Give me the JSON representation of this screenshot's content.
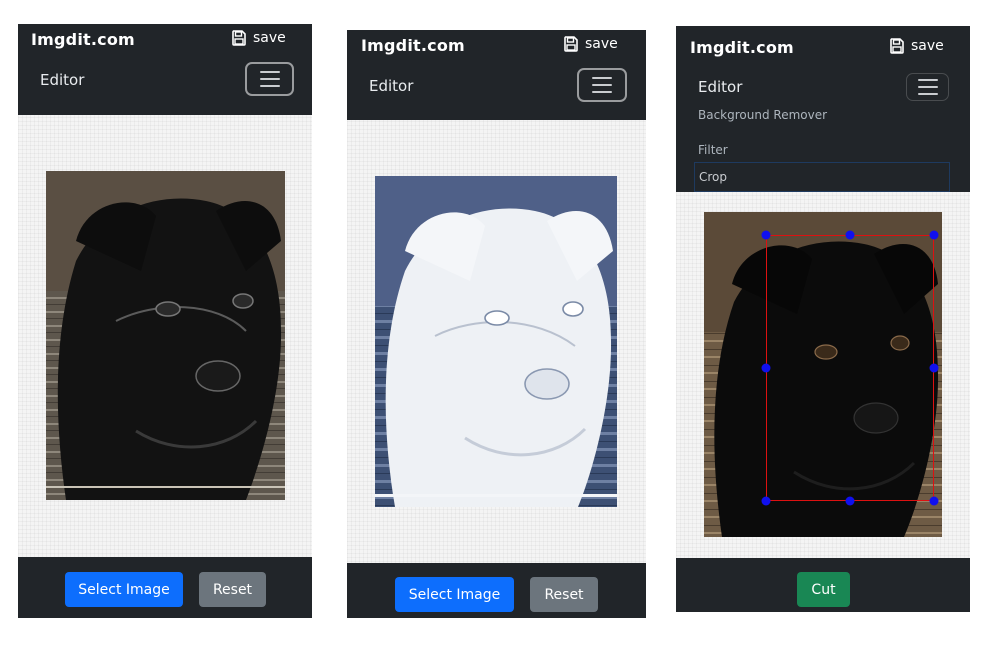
{
  "panels": [
    {
      "brand": "Imgdit.com",
      "save_label": "save",
      "editor_label": "Editor",
      "buttons": {
        "select": "Select Image",
        "reset": "Reset"
      },
      "image_filter": "emboss"
    },
    {
      "brand": "Imgdit.com",
      "save_label": "save",
      "editor_label": "Editor",
      "buttons": {
        "select": "Select Image",
        "reset": "Reset"
      },
      "image_filter": "sketch"
    },
    {
      "brand": "Imgdit.com",
      "save_label": "save",
      "editor_label": "Editor",
      "menu": {
        "items": [
          "Background Remover",
          "Filter",
          "Crop"
        ],
        "active": "Crop"
      },
      "buttons": {
        "cut": "Cut"
      },
      "image_filter": "original"
    }
  ],
  "colors": {
    "navbar": "#212529",
    "primary": "#0d6efd",
    "secondary": "#6c757d",
    "success": "#198754",
    "crop_border": "#dd1111",
    "crop_handle": "#1010ee"
  },
  "icons": [
    "save-icon",
    "hamburger-menu-icon"
  ]
}
